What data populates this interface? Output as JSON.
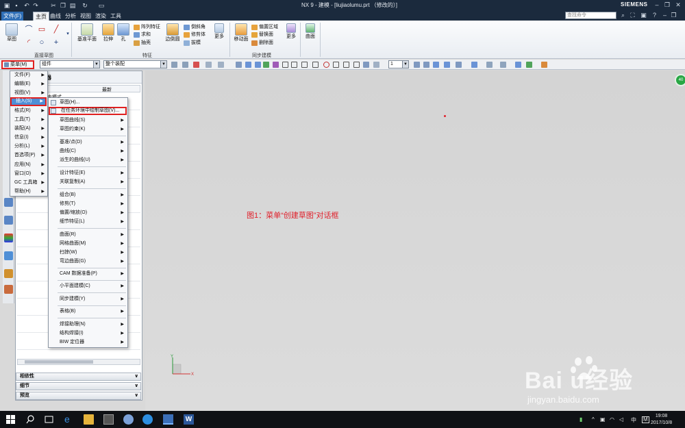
{
  "window": {
    "title": "NX 9 - 建模 - [liujiaolumu.prt （修改的）]",
    "brand": "SIEMENS"
  },
  "tabs": [
    "文件(F)",
    "主页",
    "曲线",
    "分析",
    "视图",
    "渲染",
    "工具"
  ],
  "search": {
    "placeholder": "查找命令"
  },
  "ribbon": {
    "sketch": "草图",
    "group_sketch": "直接草图",
    "datum_plane": "基准平面",
    "extrude": "拉伸",
    "hole": "孔",
    "pattern_feature": "阵列特征",
    "unite": "求和",
    "shell": "抽壳",
    "edge_blend": "边倒圆",
    "chamfer": "倒斜角",
    "trim_body": "修剪体",
    "draft": "拔模",
    "more1": "更多",
    "group_feature": "特征",
    "move_face": "移动面",
    "offset_region": "偏置区域",
    "replace_face": "替换面",
    "delete_face": "删除面",
    "more2": "更多",
    "surface": "曲面",
    "group_sync": "同步建模"
  },
  "toolbar": {
    "menu_label": "菜单(M)",
    "filter_value": "组件",
    "scope_value": "整个装配",
    "layer_value": "1"
  },
  "nav": {
    "title": "器",
    "col_latest": "最新",
    "row_mode": "史模式"
  },
  "accordion": [
    "相依性",
    "细节",
    "预览"
  ],
  "main_menu": [
    "文件(F)",
    "编辑(E)",
    "视图(V)",
    "插入(S)",
    "格式(R)",
    "工具(T)",
    "装配(A)",
    "信息(I)",
    "分析(L)",
    "首选项(P)",
    "应用(N)",
    "窗口(O)",
    "GC 工具箱",
    "帮助(H)"
  ],
  "submenu": [
    "草图(H)...",
    "在任务环境中绘制草图(V)...",
    "草图曲线(S)",
    "草图约束(K)",
    "基准/点(D)",
    "曲线(C)",
    "派生的曲线(U)",
    "设计特征(E)",
    "关联复制(A)",
    "组合(B)",
    "修剪(T)",
    "偏置/缩放(O)",
    "细节特征(L)",
    "曲面(R)",
    "网格曲面(M)",
    "扫掠(W)",
    "弯边曲面(G)",
    "CAM 数据准备(P)",
    "小平面建模(C)",
    "同步建模(Y)",
    "表格(B)",
    "焊接助理(N)",
    "结构焊接(I)",
    "BIW 定位器"
  ],
  "caption": "图1：菜单“创建草图”对话框",
  "triad": {
    "x": "X",
    "y": "Y"
  },
  "watermark": {
    "logo": "Bai  u经验",
    "url": "jingyan.baidu.com"
  },
  "green_badge": "40",
  "taskbar": {
    "time": "19:08",
    "date": "2017/10/8",
    "ime": "中",
    "ime2": "M"
  }
}
